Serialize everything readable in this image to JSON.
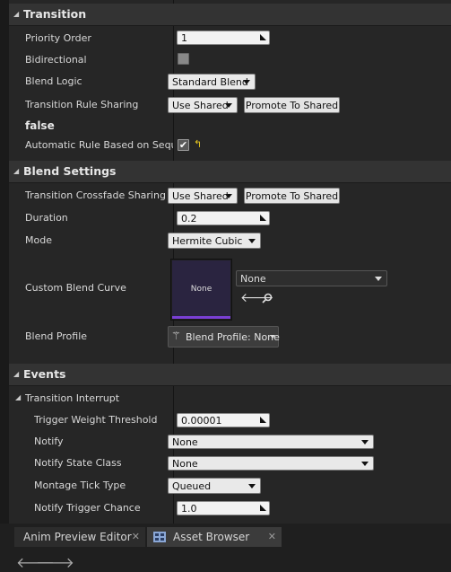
{
  "transition": {
    "header": "Transition",
    "priority_order_label": "Priority Order",
    "priority_order_value": "1",
    "bidirectional_label": "Bidirectional",
    "blend_logic_label": "Blend Logic",
    "blend_logic_value": "Standard Blend",
    "rule_sharing_label": "Transition Rule Sharing",
    "use_shared": "Use Shared",
    "promote": "Promote To Shared",
    "false_text": "false",
    "auto_rule_label": "Automatic Rule Based on Sequ"
  },
  "blend": {
    "header": "Blend Settings",
    "crossfade_label": "Transition Crossfade Sharing",
    "use_shared": "Use Shared",
    "promote": "Promote To Shared",
    "duration_label": "Duration",
    "duration_value": "0.2",
    "mode_label": "Mode",
    "mode_value": "Hermite Cubic",
    "curve_label": "Custom Blend Curve",
    "curve_thumb_text": "None",
    "curve_value": "None",
    "profile_label": "Blend Profile",
    "profile_value": "Blend Profile: None"
  },
  "events": {
    "header": "Events",
    "interrupt_header": "Transition Interrupt",
    "trigger_weight_label": "Trigger Weight Threshold",
    "trigger_weight_value": "0.00001",
    "notify_label": "Notify",
    "notify_value": "None",
    "notify_state_label": "Notify State Class",
    "notify_state_value": "None",
    "montage_label": "Montage Tick Type",
    "montage_value": "Queued",
    "chance_label": "Notify Trigger Chance",
    "chance_value": "1.0"
  },
  "tabs": {
    "anim_preview": "Anim Preview Editor",
    "asset_browser": "Asset Browser"
  }
}
